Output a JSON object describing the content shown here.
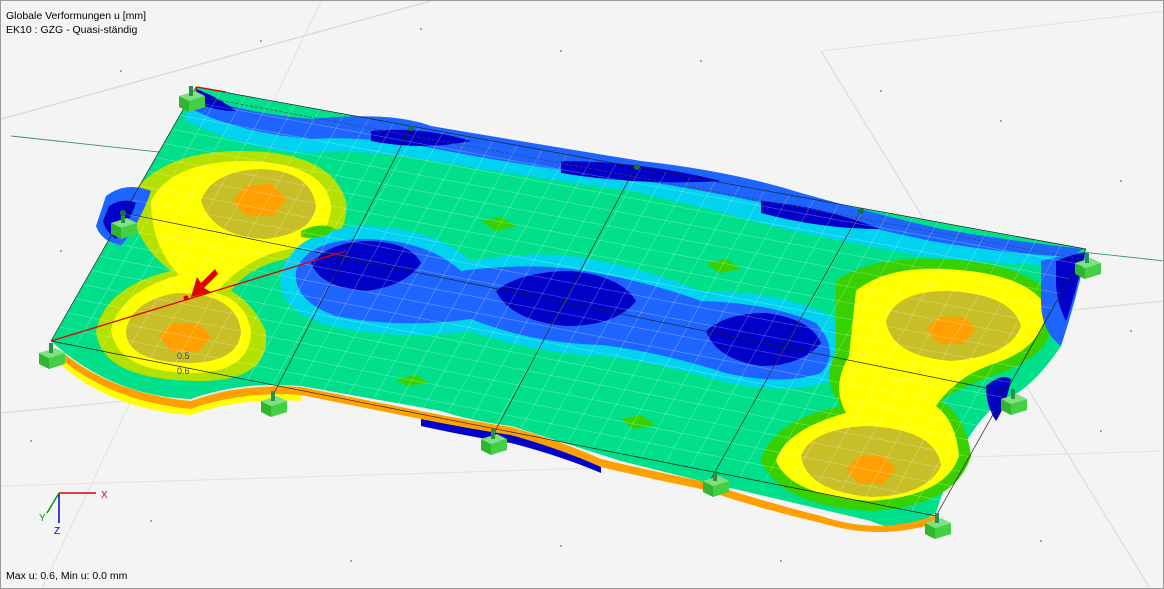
{
  "viewport": {
    "title": "Globale Verformungen u [mm]",
    "load_case": "EK10 : GZG - Quasi-ständig",
    "status": "Max u: 0.6, Min u: 0.0 mm"
  },
  "contour_labels": {
    "a": "0.5",
    "b": "0.6"
  },
  "axes": {
    "x": "X",
    "y": "Y",
    "z": "Z"
  },
  "colors": {
    "background": "#f4f4f4",
    "grid_line": "#d8d8d8",
    "level_0": "#0000c8",
    "level_1": "#1e64ff",
    "level_2": "#00d2f0",
    "level_3": "#00e08a",
    "level_4": "#39d000",
    "level_5": "#b4e100",
    "level_6": "#ffff00",
    "level_7": "#c8be28",
    "level_8": "#ffa000",
    "support": "#44d044",
    "dimension_line": "#e00000"
  }
}
